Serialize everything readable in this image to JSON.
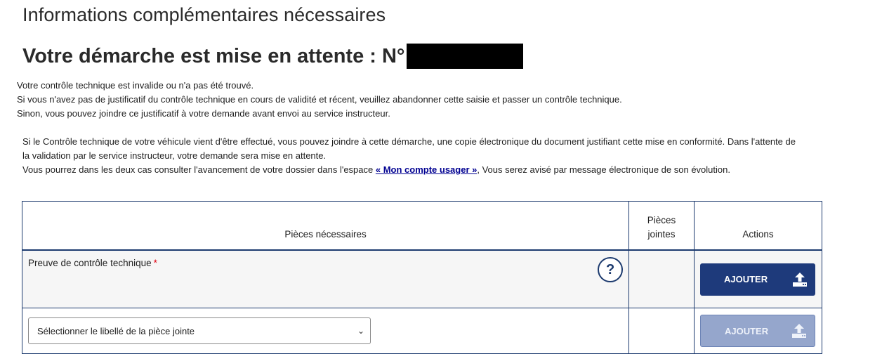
{
  "page": {
    "title": "Informations complémentaires nécessaires",
    "subtitle": "Votre démarche est mise en attente : N°"
  },
  "intro": [
    "Votre contrôle technique est invalide ou n'a pas été trouvé.",
    "Si vous n'avez pas de justificatif du contrôle technique en cours de validité et récent, veuillez abandonner cette saisie et passer un contrôle technique.",
    "Sinon, vous pouvez joindre ce justificatif à votre demande avant envoi au service instructeur."
  ],
  "notice": {
    "text1": "Si le Contrôle technique de votre véhicule vient d'être effectué, vous pouvez joindre à cette démarche, une copie électronique du document justifiant cette mise en conformité. Dans l'attente de la validation par le service instructeur, votre demande sera mise en attente.",
    "text2_before": "Vous pourrez dans les deux cas consulter l'avancement de votre dossier dans l'espace ",
    "link": "« Mon compte usager »",
    "text2_after": ", Vous serez avisé par message électronique de son évolution."
  },
  "table": {
    "headers": {
      "pieces": "Pièces nécessaires",
      "jointes": "Pièces jointes",
      "actions": "Actions"
    },
    "row1": {
      "label": "Preuve de contrôle technique",
      "required_mark": "*",
      "help_icon": "?",
      "button": "AJOUTER"
    },
    "row2": {
      "select_value": "Sélectionner le libellé de la pièce jointe",
      "button": "AJOUTER"
    }
  },
  "icons": {
    "upload": "upload-icon",
    "help": "help-icon",
    "chevron": "chevron-down-icon"
  },
  "colors": {
    "primary": "#1e3a7b",
    "disabled": "#95a6cc",
    "link": "#000091",
    "required": "#e1000f"
  }
}
